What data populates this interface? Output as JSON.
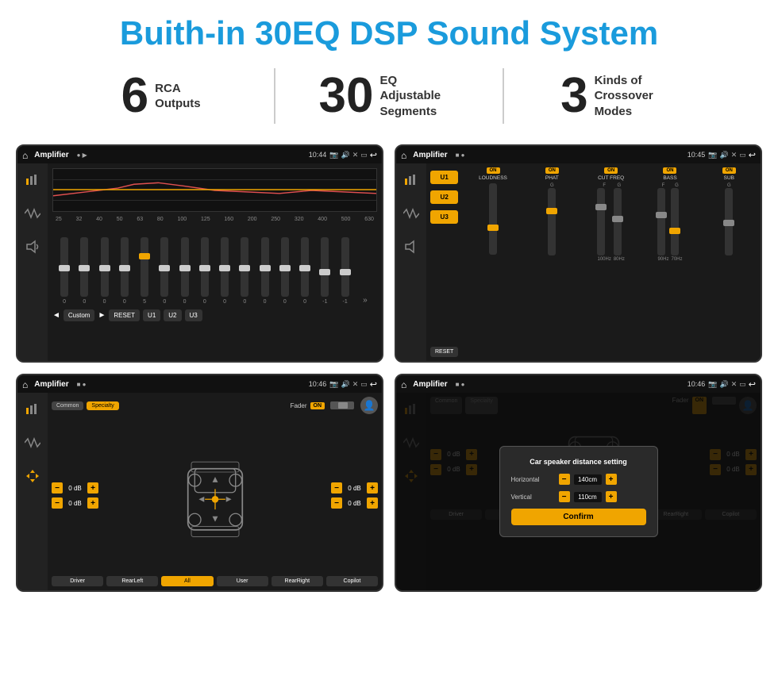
{
  "header": {
    "title": "Buith-in 30EQ DSP Sound System"
  },
  "stats": [
    {
      "number": "6",
      "label": "RCA\nOutputs"
    },
    {
      "number": "30",
      "label": "EQ Adjustable\nSegments"
    },
    {
      "number": "3",
      "label": "Kinds of\nCrossover Modes"
    }
  ],
  "screens": [
    {
      "id": "eq-screen",
      "status_bar": {
        "app": "Amplifier",
        "time": "10:44"
      },
      "eq": {
        "freq_labels": [
          "25",
          "32",
          "40",
          "50",
          "63",
          "80",
          "100",
          "125",
          "160",
          "200",
          "250",
          "320",
          "400",
          "500",
          "630"
        ],
        "slider_values": [
          "0",
          "0",
          "0",
          "0",
          "5",
          "0",
          "0",
          "0",
          "0",
          "0",
          "0",
          "0",
          "0",
          "-1",
          "0",
          "-1"
        ],
        "preset_label": "Custom",
        "buttons": [
          "RESET",
          "U1",
          "U2",
          "U3"
        ]
      }
    },
    {
      "id": "crossover-screen",
      "status_bar": {
        "app": "Amplifier",
        "time": "10:45"
      },
      "u_buttons": [
        "U1",
        "U2",
        "U3"
      ],
      "groups": [
        {
          "label": "LOUDNESS",
          "on": true
        },
        {
          "label": "PHAT",
          "on": true
        },
        {
          "label": "CUT FREQ",
          "on": true
        },
        {
          "label": "BASS",
          "on": true
        },
        {
          "label": "SUB",
          "on": true
        }
      ],
      "reset_label": "RESET"
    },
    {
      "id": "fader-screen",
      "status_bar": {
        "app": "Amplifier",
        "time": "10:46"
      },
      "tabs": [
        "Common",
        "Specialty"
      ],
      "fader_label": "Fader",
      "fader_on": "ON",
      "channel_values": [
        {
          "label": "0 dB"
        },
        {
          "label": "0 dB"
        },
        {
          "label": "0 dB"
        },
        {
          "label": "0 dB"
        }
      ],
      "bottom_buttons": [
        "Driver",
        "RearLeft",
        "All",
        "User",
        "RearRight",
        "Copilot"
      ]
    },
    {
      "id": "dialog-screen",
      "status_bar": {
        "app": "Amplifier",
        "time": "10:46"
      },
      "dialog": {
        "title": "Car speaker distance setting",
        "horizontal_label": "Horizontal",
        "horizontal_value": "140cm",
        "vertical_label": "Vertical",
        "vertical_value": "110cm",
        "confirm_label": "Confirm"
      },
      "right_values": [
        "0 dB",
        "0 dB"
      ],
      "bottom_buttons": [
        "Driver",
        "RearLeft..",
        "All",
        "User",
        "RearRight",
        "Copilot"
      ]
    }
  ]
}
